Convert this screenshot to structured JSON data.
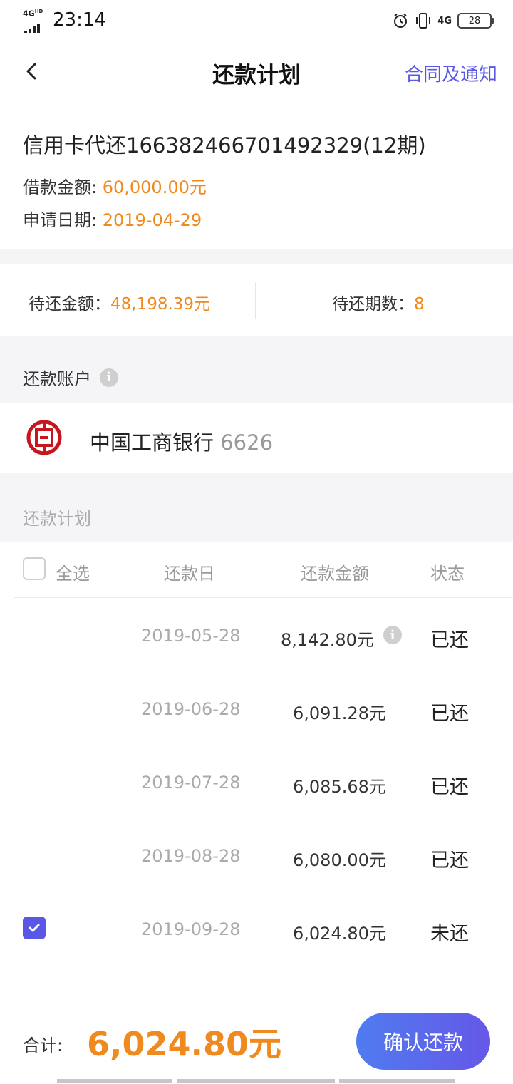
{
  "status_bar": {
    "network": "4G",
    "network_hd": "HD",
    "time": "23:14",
    "data_label": "4G",
    "battery": "28"
  },
  "header": {
    "title": "还款计划",
    "right_link": "合同及通知"
  },
  "loan": {
    "title": "信用卡代还166382466701492329(12期)",
    "amount_label": "借款金额: ",
    "amount_value": "60,000.00元",
    "date_label": "申请日期: ",
    "date_value": "2019-04-29"
  },
  "pending": {
    "amount_label": "待还金额：",
    "amount_value": "48,198.39元",
    "periods_label": "待还期数：",
    "periods_value": "8"
  },
  "account": {
    "section_label": "还款账户",
    "bank_name": "中国工商银行",
    "bank_tail": " 6626"
  },
  "plan": {
    "section_label": "还款计划",
    "columns": {
      "select_all": "全选",
      "date": "还款日",
      "amount": "还款金额",
      "status": "状态"
    },
    "rows": [
      {
        "date": "2019-05-28",
        "amount": "8,142.80元",
        "status": "已还"
      },
      {
        "date": "2019-06-28",
        "amount": "6,091.28元",
        "status": "已还"
      },
      {
        "date": "2019-07-28",
        "amount": "6,085.68元",
        "status": "已还"
      },
      {
        "date": "2019-08-28",
        "amount": "6,080.00元",
        "status": "已还"
      },
      {
        "date": "2019-09-28",
        "amount": "6,024.80元",
        "status": "未还"
      }
    ]
  },
  "footer": {
    "total_label": "合计:",
    "total_value": "6,024.80元",
    "confirm_label": "确认还款"
  },
  "colors": {
    "accent": "#5b57e6",
    "highlight": "#f0891e",
    "bank_red": "#c8161e"
  }
}
